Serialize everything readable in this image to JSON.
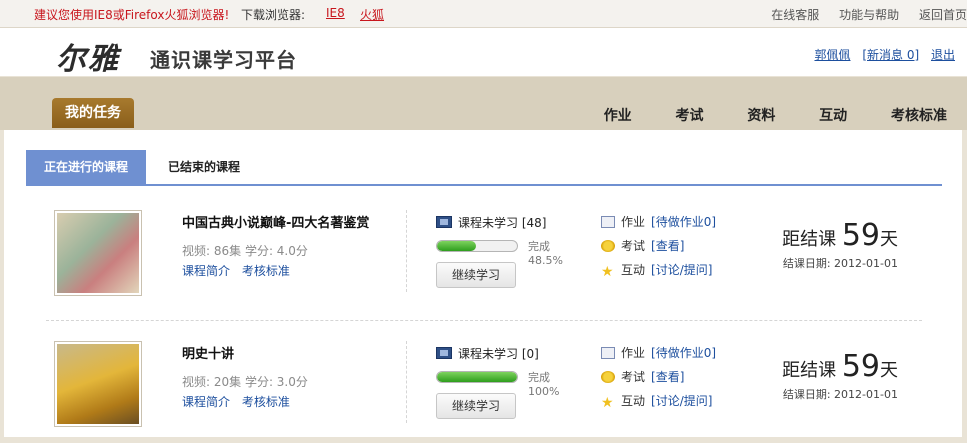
{
  "topbar": {
    "warning": "建议您使用IE8或Firefox火狐浏览器!",
    "download_label": "下载浏览器:",
    "ie8": "IE8",
    "firefox": "火狐",
    "links": [
      "在线客服",
      "功能与帮助",
      "返回首页"
    ]
  },
  "header": {
    "logo_calligraphy": "尔雅",
    "logo_text": "通识课学习平台",
    "user": "郭佩佩",
    "new_message": "[新消息 0]",
    "logout": "退出"
  },
  "nav": {
    "my_task": "我的任务",
    "items": [
      "作业",
      "考试",
      "资料",
      "互动",
      "考核标准"
    ]
  },
  "tabs": {
    "active": "正在进行的课程",
    "inactive": "已结束的课程"
  },
  "courses": [
    {
      "title": "中国古典小说巅峰-四大名著鉴赏",
      "meta": "视频: 86集  学分: 4.0分",
      "intro": "课程简介",
      "standard": "考核标准",
      "unlearned": "课程未学习 [48]",
      "progress": 0.485,
      "progress_text": "完成48.5%",
      "continue": "继续学习",
      "hw_label": "作业",
      "hw_link": "[待做作业0]",
      "exam_label": "考试",
      "exam_link": "[查看]",
      "interact_label": "互动",
      "interact_link": "[讨论/提问]",
      "days_prefix": "距结课",
      "days": "59",
      "days_suffix": "天",
      "end_date": "结课日期: 2012-01-01"
    },
    {
      "title": "明史十讲",
      "meta": "视频: 20集  学分: 3.0分",
      "intro": "课程简介",
      "standard": "考核标准",
      "unlearned": "课程未学习 [0]",
      "progress": 1.0,
      "progress_text": "完成100%",
      "continue": "继续学习",
      "hw_label": "作业",
      "hw_link": "[待做作业0]",
      "exam_label": "考试",
      "exam_link": "[查看]",
      "interact_label": "互动",
      "interact_link": "[讨论/提问]",
      "days_prefix": "距结课",
      "days": "59",
      "days_suffix": "天",
      "end_date": "结课日期: 2012-01-01"
    }
  ],
  "colors": {
    "warning": "#c8161d",
    "tab_active": "#6f90d1",
    "nav_band": "#d8d0bd",
    "my_task": "#a87a2e",
    "progress": "#2e9e1d",
    "link": "#1d4f9e"
  }
}
